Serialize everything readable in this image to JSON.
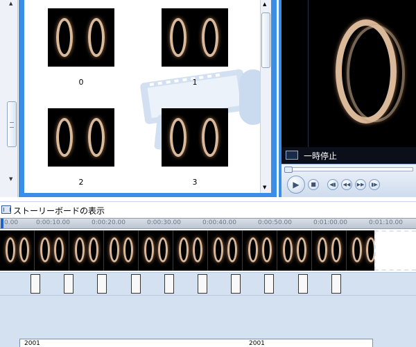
{
  "collections": {
    "clips": [
      {
        "label": "0"
      },
      {
        "label": "1"
      },
      {
        "label": "2"
      },
      {
        "label": "3"
      }
    ]
  },
  "player": {
    "status_text": "一時停止",
    "seek_progress": 0.0
  },
  "storyboard": {
    "label": "ストーリーボードの表示"
  },
  "timeline": {
    "ruler_labels": [
      "0.00",
      "0:00:10.00",
      "0:00:20.00",
      "0:00:30.00",
      "0:00:40.00",
      "0:00:50.00",
      "0:01:00.00",
      "0:01:10.00"
    ],
    "clip_count": 11,
    "transition_count": 10,
    "title_track_labels": [
      "2001",
      "2001"
    ]
  },
  "colors": {
    "panel_blue": "#3a8ee6",
    "track_blue": "#d4e1f1",
    "playhead": "#1f5fcf"
  },
  "icons": {
    "play": "play-icon",
    "stop": "stop-icon",
    "prev": "previous-frame-icon",
    "next": "next-frame-icon",
    "storyboard": "storyboard-icon"
  }
}
